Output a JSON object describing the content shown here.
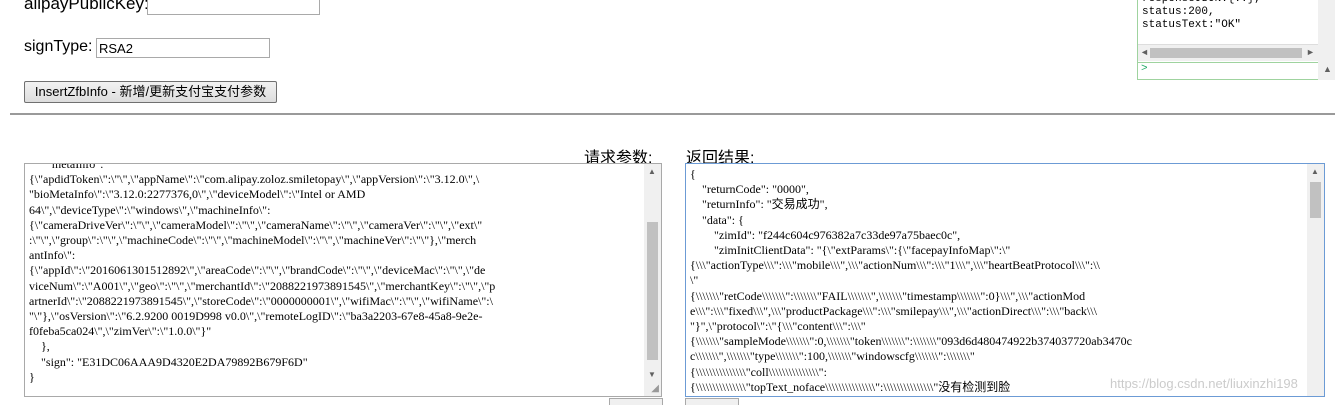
{
  "form": {
    "alipay_public_key_label": "alipayPublicKey:",
    "alipay_public_key_value": "",
    "sign_type_label": "signType:",
    "sign_type_value": "RSA2",
    "insert_button_label": "InsertZfbInfo - 新增/更新支付宝支付参数"
  },
  "console": {
    "lines": "responseJSON:{..},\nstatus:200,\nstatusText:\"OK\"",
    "left_arrow": "◄",
    "right_arrow": "►",
    "prompt": ">"
  },
  "request": {
    "label": "请求参数:",
    "text": "      \"metaInfo\": \"\n{\\\"apdidToken\\\":\\\"\\\",\\\"appName\\\":\\\"com.alipay.zoloz.smiletopay\\\",\\\"appVersion\\\":\\\"3.12.0\\\",\\\n\"bioMetaInfo\\\":\\\"3.12.0:2277376,0\\\",\\\"deviceModel\\\":\\\"Intel or AMD\n64\\\",\\\"deviceType\\\":\\\"windows\\\",\\\"machineInfo\\\":\n{\\\"cameraDriveVer\\\":\\\"\\\",\\\"cameraModel\\\":\\\"\\\",\\\"cameraName\\\":\\\"\\\",\\\"cameraVer\\\":\\\"\\\",\\\"ext\\\"\n:\\\"\\\",\\\"group\\\":\\\"\\\",\\\"machineCode\\\":\\\"\\\",\\\"machineModel\\\":\\\"\\\",\\\"machineVer\\\":\\\"\\\"},\\\"merch\nantInfo\\\":\n{\\\"appId\\\":\\\"2016061301512892\\\",\\\"areaCode\\\":\\\"\\\",\\\"brandCode\\\":\\\"\\\",\\\"deviceMac\\\":\\\"\\\",\\\"de\nviceNum\\\":\\\"A001\\\",\\\"geo\\\":\\\"\\\",\\\"merchantId\\\":\\\"2088221973891545\\\",\\\"merchantKey\\\":\\\"\\\",\\\"p\nartnerId\\\":\\\"2088221973891545\\\",\\\"storeCode\\\":\\\"0000000001\\\",\\\"wifiMac\\\":\\\"\\\",\\\"wifiName\\\":\\\n\"\\\"},\\\"osVersion\\\":\\\"6.2.9200 0019D998 v0.0\\\",\\\"remoteLogID\\\":\\\"ba3a2203-67e8-45a8-9e2e-\nf0feba5ca024\\\",\\\"zimVer\\\":\\\"1.0.0\\\"}\"\n    },\n    \"sign\": \"E31DC06AAA9D4320E2DA79892B679F6D\"\n}"
  },
  "response": {
    "label": "返回结果:",
    "lines": [
      "{",
      "    \"returnCode\": \"0000\",",
      "    \"returnInfo\": \"交易成功\",",
      "    \"data\": {",
      "        \"zimId\": \"f244c604c976382a7c33de97a75baec0c\",",
      "        \"zimInitClientData\": \"{\\\"extParams\\\":{\\\"facepayInfoMap\\\":\\\"",
      "{\\\\\\\"actionType\\\\\\\":\\\\\\\"mobile\\\\\\\",\\\\\\\"actionNum\\\\\\\":\\\\\\\"1\\\\\\\",\\\\\\\"heartBeatProtocol\\\\\\\":\\\\",
      "\\\"",
      "{\\\\\\\\\\\\\\\"retCode\\\\\\\\\\\\\\\":\\\\\\\\\\\\\\\"FAIL\\\\\\\\\\\\\\\",\\\\\\\\\\\\\\\"timestamp\\\\\\\\\\\\\\\":0}\\\\\\\",\\\\\\\"actionMod",
      "e\\\\\\\":\\\\\\\"fixed\\\\\\\",\\\\\\\"productPackage\\\\\\\":\\\\\\\"smilepay\\\\\\\",\\\\\\\"actionDirect\\\\\\\":\\\\\\\"back\\\\\\",
      "\"}\",\\\"protocol\\\":\\\"{\\\\\\\"content\\\\\\\":\\\\\\\"",
      "{\\\\\\\\\\\\\\\"sampleMode\\\\\\\\\\\\\\\":0,\\\\\\\\\\\\\\\"token\\\\\\\\\\\\\\\":\\\\\\\\\\\\\\\"093d6d480474922b374037720ab3470c",
      "c\\\\\\\\\\\\\\\",\\\\\\\\\\\\\\\"type\\\\\\\\\\\\\\\":100,\\\\\\\\\\\\\\\"windowscfg\\\\\\\\\\\\\\\":\\\\\\\\\\\\\\\"",
      "{\\\\\\\\\\\\\\\\\\\\\\\\\\\\\\\"coll\\\\\\\\\\\\\\\\\\\\\\\\\\\\\\\":",
      "{\\\\\\\\\\\\\\\\\\\\\\\\\\\\\\\"topText_noface\\\\\\\\\\\\\\\\\\\\\\\\\\\\\\\":\\\\\\\\\\\\\\\\\\\\\\\\\\\\\\\"没有检测到脸"
    ]
  },
  "watermark": "https://blog.csdn.net/liuxinzhi198"
}
